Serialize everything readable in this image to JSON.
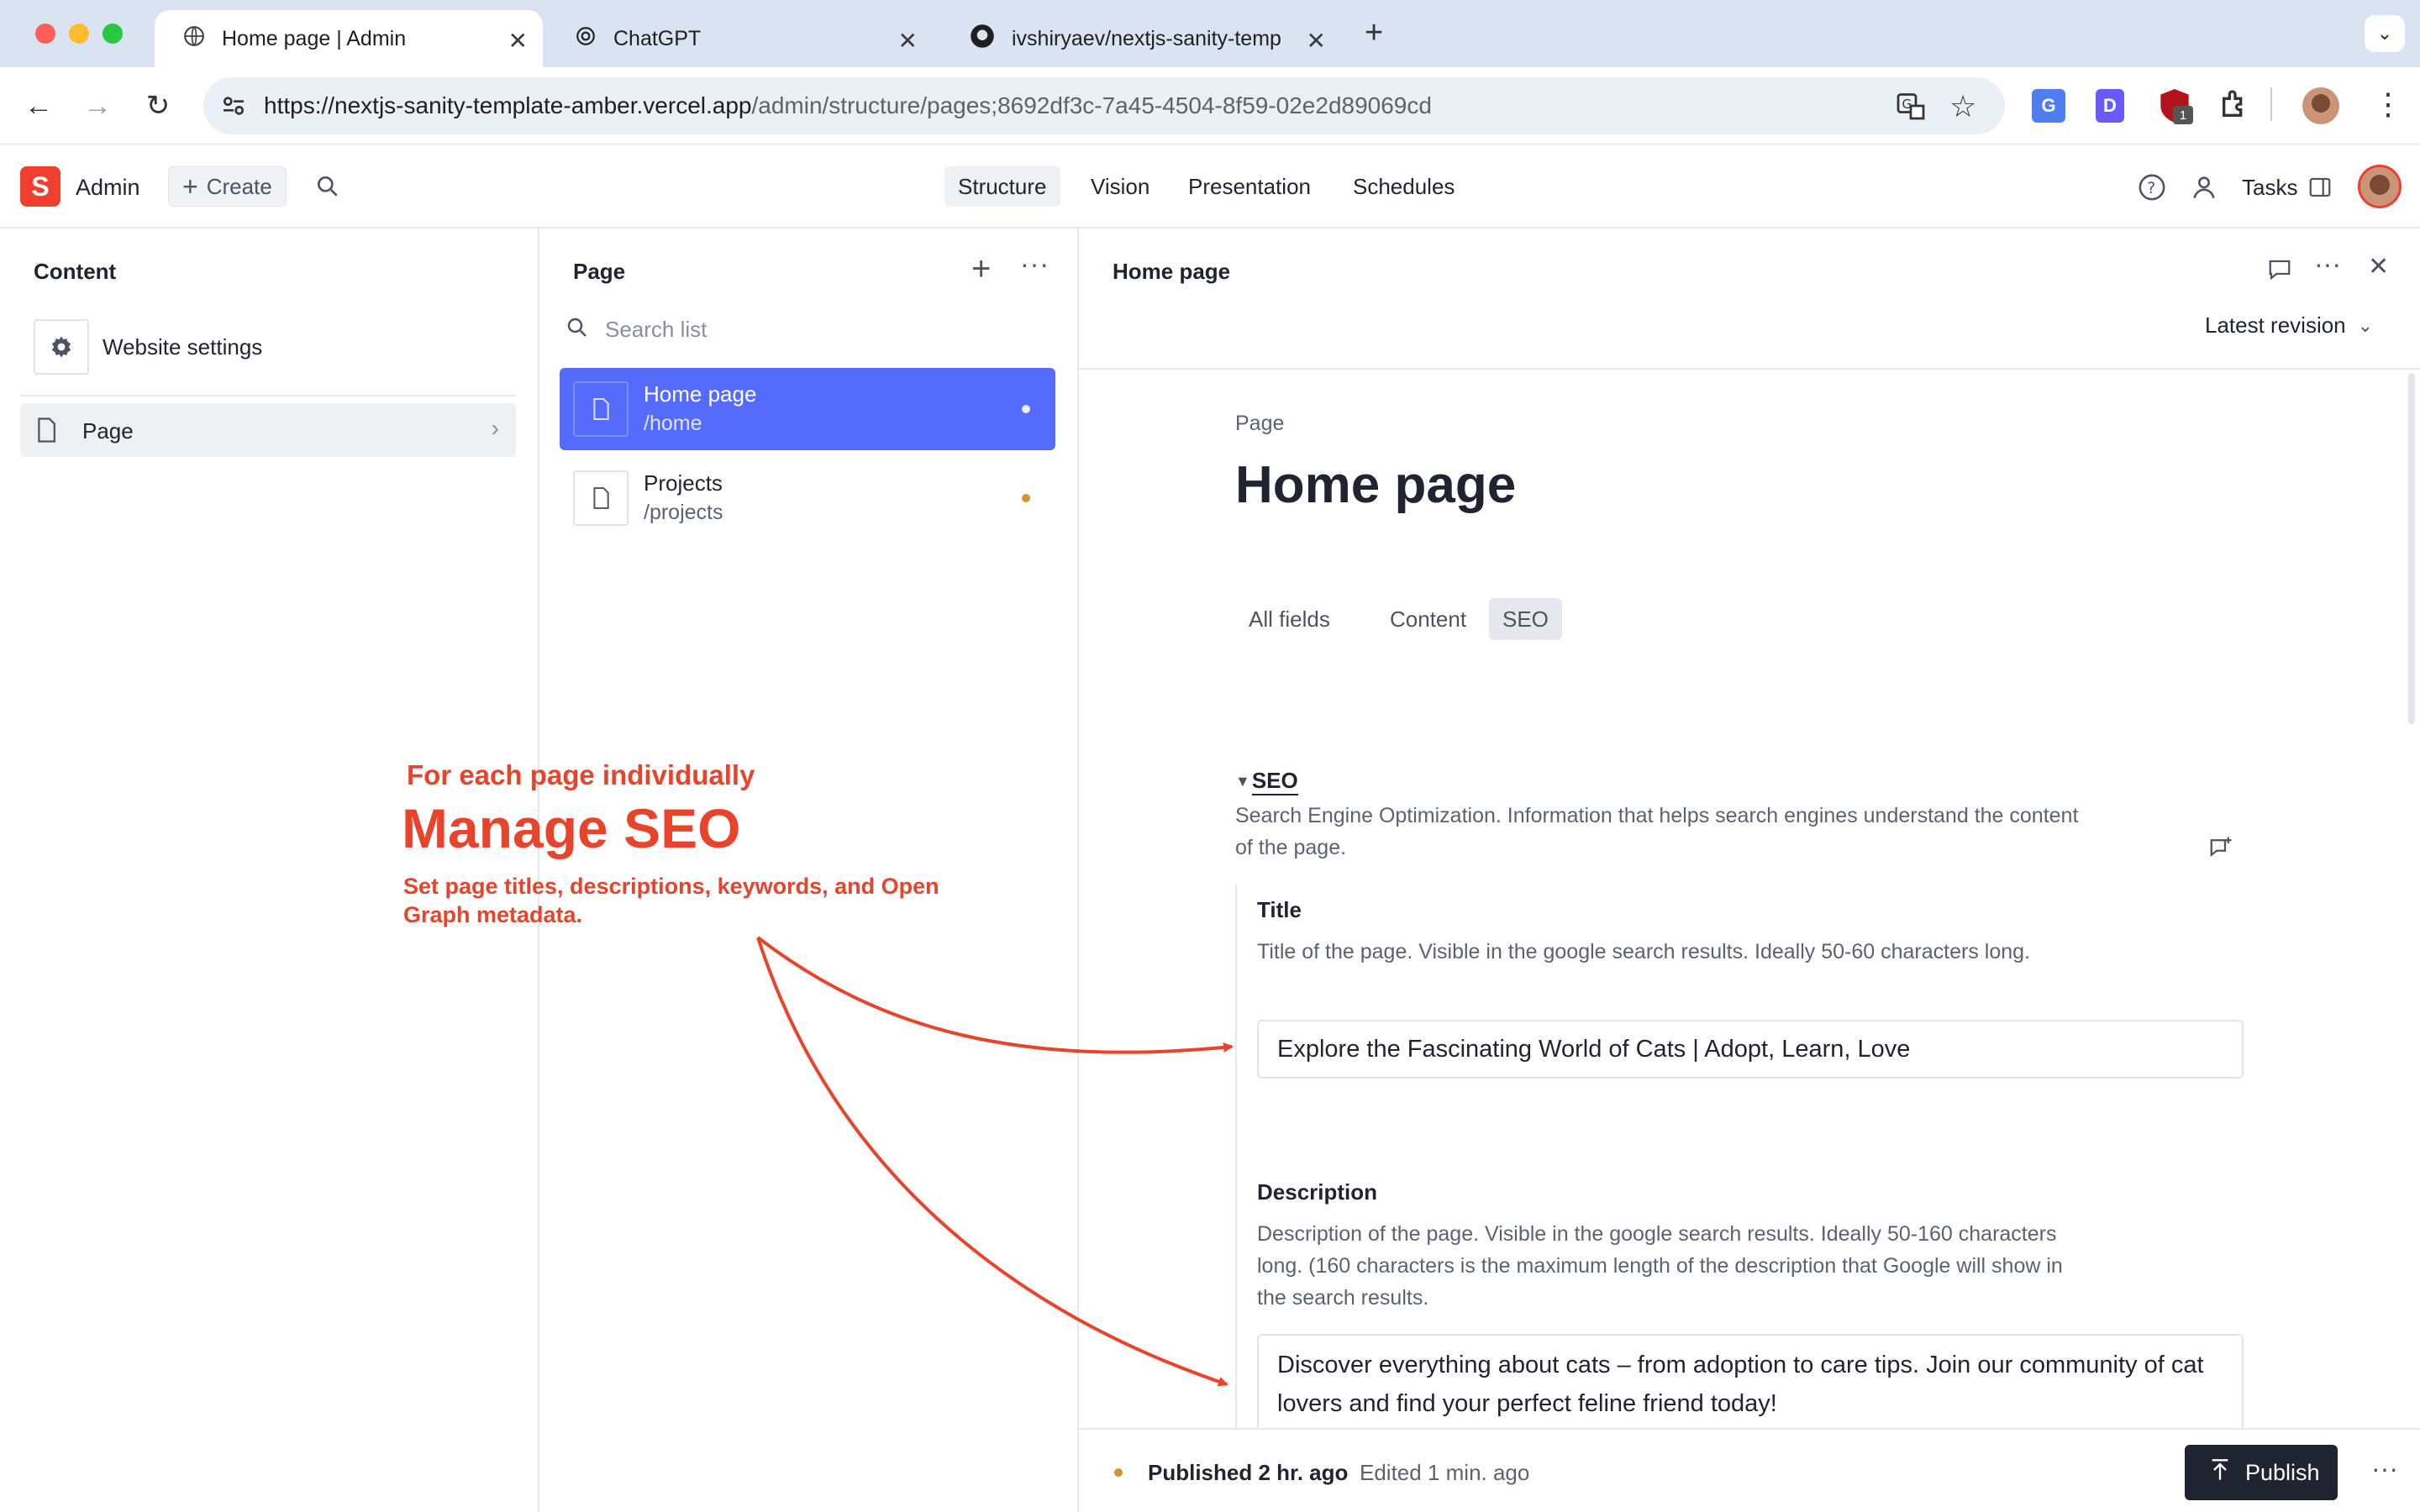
{
  "browser": {
    "tabs": [
      {
        "title": "Home page | Admin",
        "icon": "globe-icon",
        "active": true
      },
      {
        "title": "ChatGPT",
        "icon": "chatgpt-icon",
        "active": false
      },
      {
        "title": "ivshiryaev/nextjs-sanity-temp",
        "icon": "github-icon",
        "active": false
      }
    ],
    "url_host": "https://nextjs-sanity-template-amber.vercel.app",
    "url_path": "/admin/structure/pages;8692df3c-7a45-4504-8f59-02e2d89069cd",
    "extension_badge": "1"
  },
  "app": {
    "logo_letter": "S",
    "workspace": "Admin",
    "create_label": "Create",
    "nav": [
      "Structure",
      "Vision",
      "Presentation",
      "Schedules"
    ],
    "tasks_label": "Tasks"
  },
  "content_pane": {
    "title": "Content",
    "items": [
      {
        "label": "Website settings",
        "icon": "gear-icon"
      },
      {
        "label": "Page",
        "icon": "document-icon"
      }
    ]
  },
  "page_pane": {
    "title": "Page",
    "search_placeholder": "Search list",
    "docs": [
      {
        "title": "Home page",
        "slug": "/home",
        "selected": true,
        "status_color": "#e9ebff"
      },
      {
        "title": "Projects",
        "slug": "/projects",
        "selected": false,
        "status_color": "#d6922d"
      }
    ]
  },
  "editor": {
    "header_title": "Home page",
    "revision_label": "Latest revision",
    "doc_type": "Page",
    "doc_title": "Home page",
    "tabs": [
      "All fields",
      "Content",
      "SEO"
    ],
    "active_tab": "SEO",
    "seo_group": {
      "label": "SEO",
      "description": "Search Engine Optimization. Information that helps search engines understand the content of the page."
    },
    "fields": {
      "title": {
        "label": "Title",
        "description": "Title of the page. Visible in the google search results. Ideally 50-60 characters long.",
        "value": "Explore the Fascinating World of Cats | Adopt, Learn, Love"
      },
      "description": {
        "label": "Description",
        "description": "Description of the page. Visible in the google search results. Ideally 50-160 characters long. (160 characters is the maximum length of the description that Google will show in the search results.",
        "value": "Discover everything about cats – from adoption to care tips. Join our community of cat lovers and find your perfect feline friend today!"
      }
    },
    "footer": {
      "published": "Published 2 hr. ago",
      "edited": "Edited 1 min. ago",
      "publish_label": "Publish"
    }
  },
  "annotation": {
    "kicker": "For each page individually",
    "headline": "Manage SEO",
    "body": "Set page titles, descriptions, keywords, and Open Graph metadata."
  },
  "colors": {
    "accent": "#556bfc",
    "brand": "#f03e2f",
    "annotation": "#e8442b",
    "publish_button": "#1f2430"
  }
}
